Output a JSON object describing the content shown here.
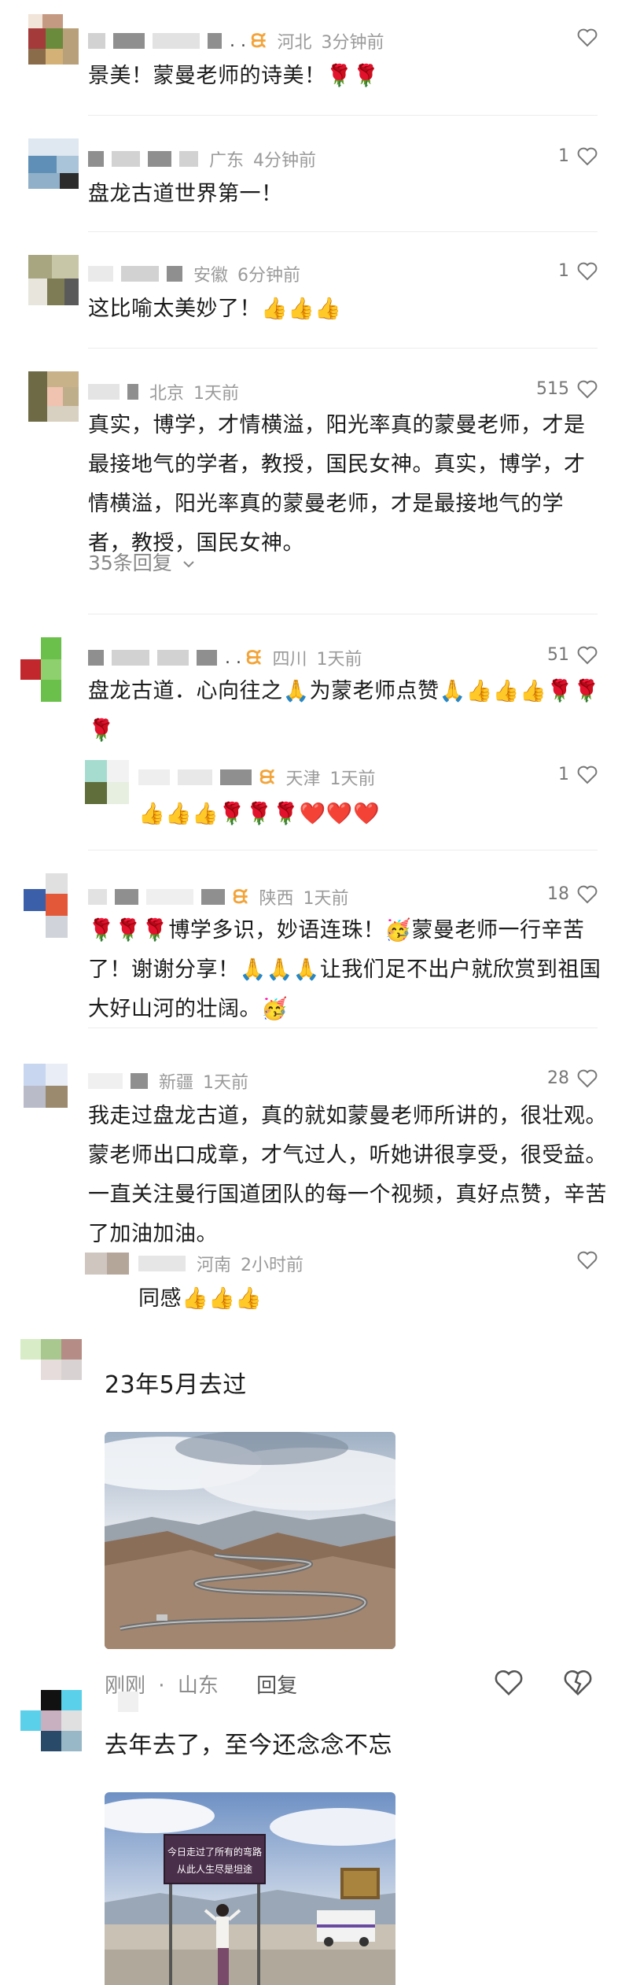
{
  "comments": [
    {
      "location": "河北",
      "time": "3分钟前",
      "likes": "",
      "text": "景美！蒙曼老师的诗美！🌹🌹"
    },
    {
      "location": "广东",
      "time": "4分钟前",
      "likes": "1",
      "text": "盘龙古道世界第一！"
    },
    {
      "location": "安徽",
      "time": "6分钟前",
      "likes": "1",
      "text": "这比喻太美妙了！👍👍👍"
    },
    {
      "location": "北京",
      "time": "1天前",
      "likes": "515",
      "text": "真实，博学，才情横溢，阳光率真的蒙曼老师，才是最接地气的学者，教授，国民女神。真实，博学，才情横溢，阳光率真的蒙曼老师，才是最接地气的学者，教授，国民女神。",
      "replies_label": "35条回复"
    },
    {
      "location": "四川",
      "time": "1天前",
      "likes": "51",
      "text": "盘龙古道．心向往之🙏为蒙老师点赞🙏👍👍👍🌹🌹🌹"
    },
    {
      "location": "天津",
      "time": "1天前",
      "likes": "1",
      "text": "👍👍👍🌹🌹🌹❤️❤️❤️"
    },
    {
      "location": "陕西",
      "time": "1天前",
      "likes": "18",
      "text": "🌹🌹🌹博学多识，妙语连珠！🥳蒙曼老师一行辛苦了！谢谢分享！🙏🙏🙏让我们足不出户就欣赏到祖国大好山河的壮阔。🥳"
    },
    {
      "location": "新疆",
      "time": "1天前",
      "likes": "28",
      "text": "我走过盘龙古道，真的就如蒙曼老师所讲的，很壮观。蒙老师出口成章，才气过人，听她讲很享受，很受益。一直关注曼行国道团队的每一个视频，真好点赞，辛苦了加油加油。"
    },
    {
      "location": "河南",
      "time": "2小时前",
      "likes": "",
      "text": "同感👍👍👍"
    }
  ],
  "post1": {
    "text": "23年5月去过",
    "time": "刚刚",
    "location": "山东",
    "reply_label": "回复",
    "separator": "·"
  },
  "post2": {
    "text": "去年去了，至今还念念不忘",
    "sign_line1": "今日走过了所有的弯路",
    "sign_line2": "从此人生尽是坦途"
  },
  "icons": {
    "like": "heart-outline-icon",
    "dislike": "broken-heart-icon",
    "vip": "vip-badge-icon",
    "chevron": "chevron-down-icon"
  },
  "colors": {
    "meta": "#9a9a9a",
    "vip": "#f2a43a",
    "text": "#1b1b1b"
  }
}
